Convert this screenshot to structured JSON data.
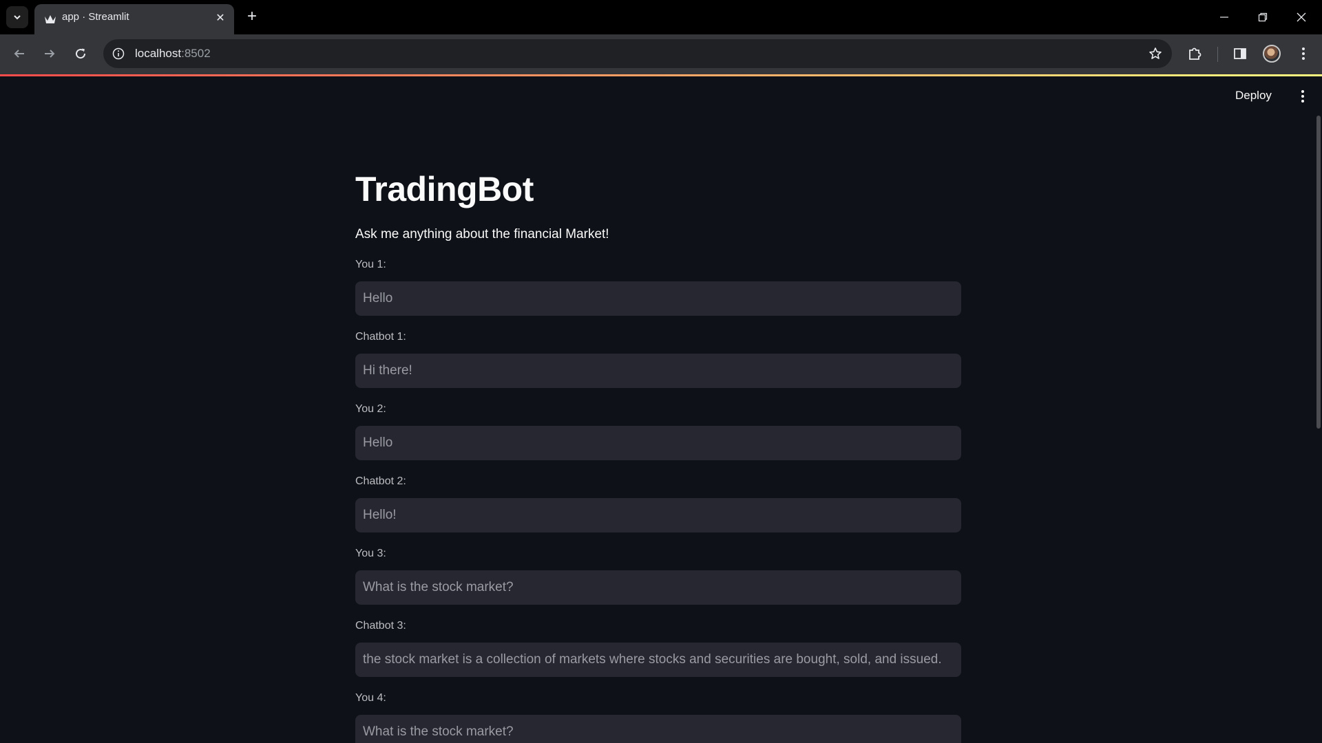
{
  "browser": {
    "tab_title": "app · Streamlit",
    "url_host": "localhost",
    "url_port": ":8502"
  },
  "app": {
    "deploy_label": "Deploy",
    "title": "TradingBot",
    "subtitle": "Ask me anything about the financial Market!",
    "conversation": [
      {
        "label": "You 1:",
        "value": "Hello"
      },
      {
        "label": "Chatbot 1:",
        "value": "Hi there!"
      },
      {
        "label": "You 2:",
        "value": "Hello"
      },
      {
        "label": "Chatbot 2:",
        "value": "Hello!"
      },
      {
        "label": "You 3:",
        "value": "What is the stock market?"
      },
      {
        "label": "Chatbot 3:",
        "value": "the stock market is a collection of markets where stocks and securities are bought, sold, and issued."
      },
      {
        "label": "You 4:",
        "value": "What is the stock market?"
      }
    ]
  },
  "colors": {
    "background": "#0e1117",
    "input_background": "#262730",
    "accent_gradient_start": "#ff4b4b",
    "accent_gradient_end": "#fffd80"
  }
}
